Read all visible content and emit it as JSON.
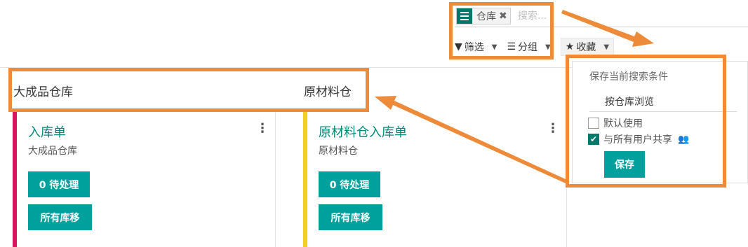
{
  "search": {
    "facet_label": "仓库",
    "facet_remove": "✖",
    "placeholder": "搜索..."
  },
  "search_options": {
    "filter_label": "筛选",
    "groupby_label": "分组",
    "favorites_label": "收藏"
  },
  "kanban": {
    "columns": [
      {
        "header": "大成品仓库",
        "card": {
          "title": "入库单",
          "subtitle": "大成品仓库",
          "todo_button": "0 待处理",
          "all_moves_button": "所有库移",
          "color": "#d6145f"
        }
      },
      {
        "header": "原材料仓",
        "card": {
          "title": "原材料仓入库单",
          "subtitle": "原材料仓",
          "todo_button": "0 待处理",
          "all_moves_button": "所有库移",
          "color": "#f2cf1f"
        }
      }
    ]
  },
  "favorites_dropdown": {
    "title": "保存当前搜索条件",
    "name_value": "按仓库浏览",
    "default_label": "默认使用",
    "default_checked": false,
    "share_label": "与所有用户共享",
    "share_checked": true,
    "save_button": "保存"
  },
  "colors": {
    "primary": "#00a09d",
    "brand_dark": "#00786a",
    "highlight": "#ee8b3a"
  },
  "icons": {
    "facet": "hamburger-icon",
    "filter": "funnel-icon",
    "groupby": "list-icon",
    "favorites": "star-icon",
    "card_menu": "vertical-dots-icon",
    "share": "users-icon"
  }
}
